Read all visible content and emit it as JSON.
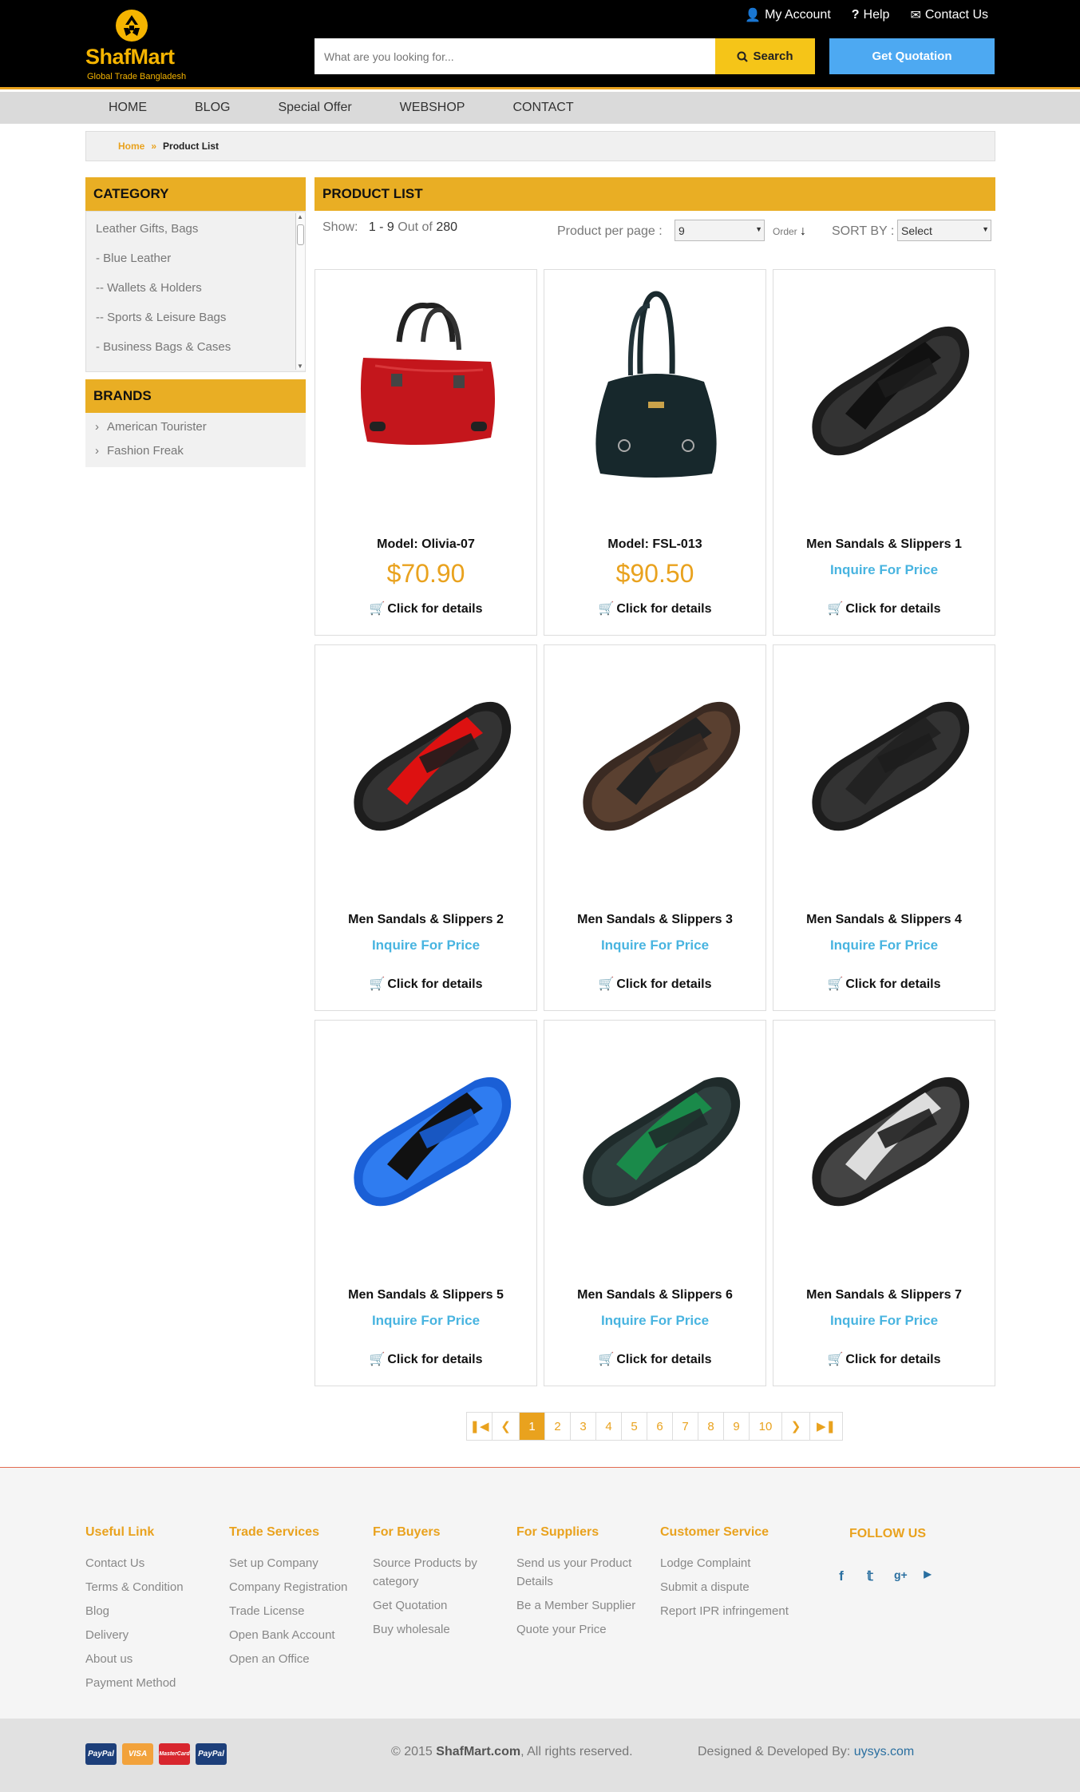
{
  "header": {
    "logo_brand": "ShafMart",
    "logo_tagline": "Global Trade Bangladesh",
    "links": [
      "My Account",
      "Help",
      "Contact Us"
    ],
    "search_placeholder": "What are you looking for...",
    "search_label": "Search",
    "quote_label": "Get Quotation"
  },
  "nav": [
    "HOME",
    "BLOG",
    "Special Offer",
    "WEBSHOP",
    "CONTACT"
  ],
  "breadcrumb": {
    "home": "Home",
    "sep": "»",
    "current": "Product List"
  },
  "sidebar": {
    "category_title": "CATEGORY",
    "categories": [
      "Leather Gifts, Bags",
      "- Blue Leather",
      "-- Wallets & Holders",
      "-- Sports & Leisure Bags",
      "- Business Bags & Cases"
    ],
    "brands_title": "BRANDS",
    "brands": [
      "American Tourister",
      "Fashion Freak"
    ]
  },
  "product_list": {
    "title": "PRODUCT LIST",
    "show_label": "Show:",
    "range": "1 - 9",
    "out_of_label": "Out of",
    "total": "280",
    "per_page_label": "Product per page :",
    "per_page_value": "9",
    "order_label": "Order",
    "sort_label": "SORT BY :",
    "sort_value": "Select",
    "details_label": "Click for details",
    "products": [
      {
        "name": "Model: Olivia-07",
        "price": "$70.90",
        "icon": "red-handbag"
      },
      {
        "name": "Model: FSL-013",
        "price": "$90.50",
        "icon": "black-handbag"
      },
      {
        "name": "Men Sandals & Slippers 1",
        "price": "Inquire For Price",
        "icon": "sandal"
      },
      {
        "name": "Men Sandals & Slippers 2",
        "price": "Inquire For Price",
        "icon": "sandal"
      },
      {
        "name": "Men Sandals & Slippers 3",
        "price": "Inquire For Price",
        "icon": "sandal"
      },
      {
        "name": "Men Sandals & Slippers 4",
        "price": "Inquire For Price",
        "icon": "sandal"
      },
      {
        "name": "Men Sandals & Slippers 5",
        "price": "Inquire For Price",
        "icon": "sandal"
      },
      {
        "name": "Men Sandals & Slippers 6",
        "price": "Inquire For Price",
        "icon": "sandal"
      },
      {
        "name": "Men Sandals & Slippers 7",
        "price": "Inquire For Price",
        "icon": "sandal"
      }
    ]
  },
  "pagination": {
    "first": "first-page-icon",
    "prev": "prev-page-icon",
    "pages": [
      "1",
      "2",
      "3",
      "4",
      "5",
      "6",
      "7",
      "8",
      "9",
      "10"
    ],
    "current": "1",
    "next": "next-page-icon",
    "last": "last-page-icon"
  },
  "footer": {
    "columns": [
      {
        "title": "Useful Link",
        "links": [
          "Contact Us",
          "Terms & Condition",
          "Blog",
          "Delivery",
          "About us",
          "Payment Method"
        ]
      },
      {
        "title": "Trade Services",
        "links": [
          "Set up Company",
          "Company Registration",
          "Trade License",
          "Open Bank Account",
          "Open an Office"
        ]
      },
      {
        "title": "For Buyers",
        "links": [
          "Source Products by category",
          "Get Quotation",
          "Buy wholesale"
        ]
      },
      {
        "title": "For Suppliers",
        "links": [
          "Send us your Product Details",
          "Be a Member Supplier",
          "Quote your Price"
        ]
      },
      {
        "title": "Customer Service",
        "links": [
          "Lodge Complaint",
          "Submit a dispute",
          "Report IPR infringement"
        ]
      }
    ],
    "follow_title": "FOLLOW US",
    "social": [
      "facebook-icon",
      "twitter-icon",
      "google-plus-icon",
      "youtube-icon"
    ],
    "payments": [
      "PayPal",
      "VISA",
      "MasterCard",
      "PayPal"
    ],
    "copyright_prefix": "© 2015",
    "copyright_site": "ShafMart.com",
    "copyright_suffix": ", All rights reserved.",
    "dev_label": "Designed & Developed By:",
    "dev_link": "uysys.com"
  },
  "colors": {
    "accent": "#e9a21e",
    "link_blue": "#48b4e0",
    "quote_button": "#4da9f2",
    "search_button": "#f5c518"
  }
}
